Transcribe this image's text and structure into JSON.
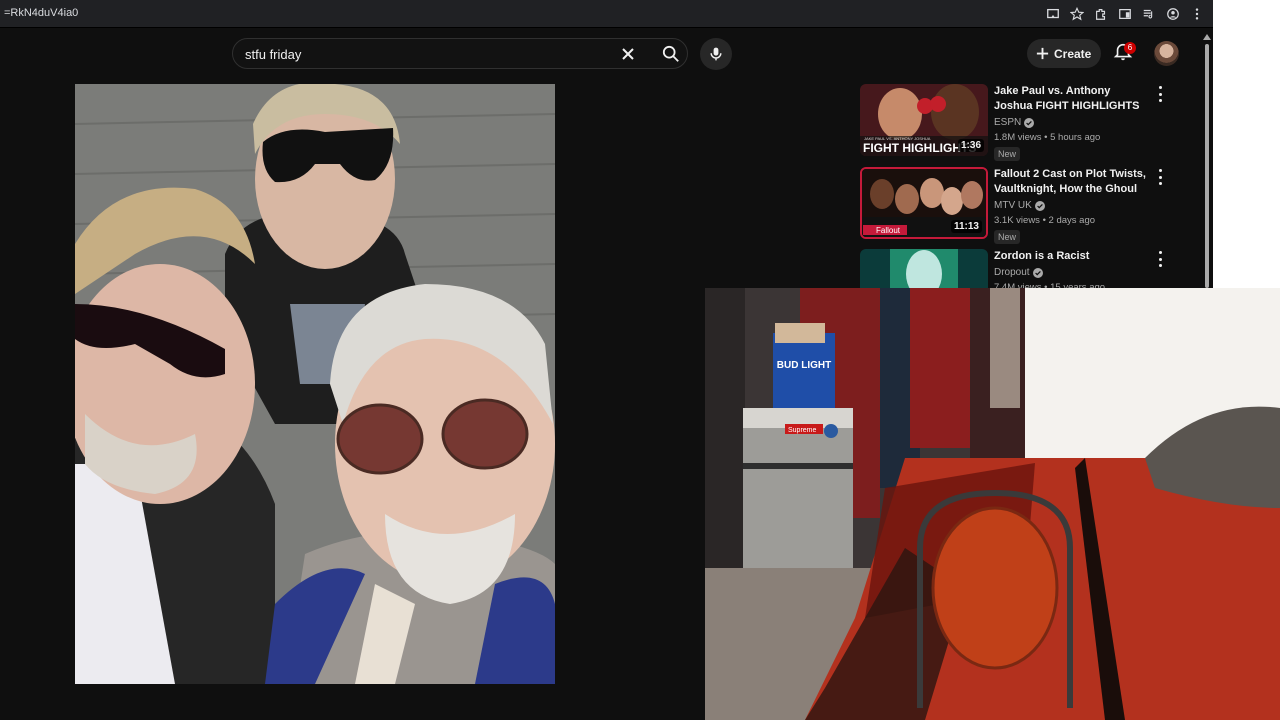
{
  "browser": {
    "url_fragment": "=RkN4duV4ia0"
  },
  "header": {
    "search_value": "stfu friday",
    "create_label": "Create",
    "notification_count": "6"
  },
  "recommendations": [
    {
      "title": "Jake Paul vs. Anthony Joshua FIGHT HIGHLIGHTS 🥊 | ESP...",
      "thumb_caption": "FIGHT HIGHLIGHTS",
      "thumb_subcaption": "JAKE PAUL VS. ANTHONY JOSHUA",
      "duration": "1:36",
      "channel": "ESPN",
      "views": "1.8M views",
      "age": "5 hours ago",
      "badge": "New"
    },
    {
      "title": "Fallout 2 Cast on Plot Twists, Vaultknight, How the Ghoul ...",
      "thumb_caption": "Fallout",
      "duration": "11:13",
      "channel": "MTV UK",
      "views": "3.1K views",
      "age": "2 days ago",
      "badge": "New"
    },
    {
      "title": "Zordon is a Racist",
      "channel": "Dropout",
      "views": "7.4M views",
      "age": "15 years ago"
    }
  ],
  "webcam": {
    "box_brand": "BUD LIGHT",
    "sticker_text": "Supreme"
  },
  "colors": {
    "background": "#0f0f0f",
    "accent_red": "#cc0000",
    "text_secondary": "#aaaaaa"
  }
}
